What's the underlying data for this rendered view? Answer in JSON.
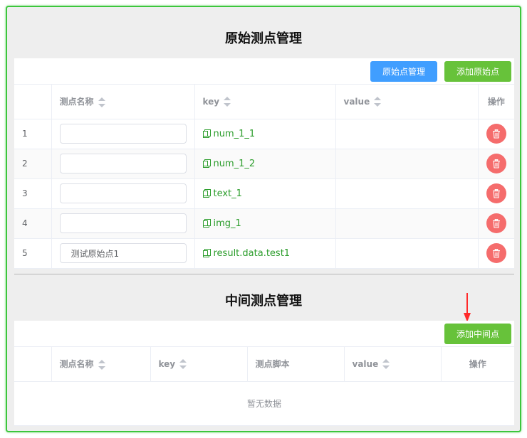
{
  "original": {
    "title": "原始测点管理",
    "buttons": {
      "manage": "原始点管理",
      "add": "添加原始点"
    },
    "columns": {
      "name": "测点名称",
      "key": "key",
      "value": "value",
      "action": "操作"
    },
    "rows": [
      {
        "index": "1",
        "name": "",
        "key": "num_1_1",
        "value": ""
      },
      {
        "index": "2",
        "name": "",
        "key": "num_1_2",
        "value": ""
      },
      {
        "index": "3",
        "name": "",
        "key": "text_1",
        "value": ""
      },
      {
        "index": "4",
        "name": "",
        "key": "img_1",
        "value": ""
      },
      {
        "index": "5",
        "name": "测试原始点1",
        "key": "result.data.test1",
        "value": ""
      }
    ]
  },
  "intermediate": {
    "title": "中间测点管理",
    "buttons": {
      "add": "添加中间点"
    },
    "columns": {
      "name": "测点名称",
      "key": "key",
      "script": "测点脚本",
      "value": "value",
      "action": "操作"
    },
    "empty_text": "暂无数据"
  },
  "colors": {
    "primary": "#409eff",
    "success": "#67c23a",
    "danger": "#f56c6c",
    "key_text": "#2c9d2c",
    "frame_border": "#3cc63c",
    "annotation_arrow": "#ff2a2a"
  },
  "icons": {
    "sort": "sort-caret-icon",
    "copy": "copy-icon",
    "delete": "trash-icon",
    "annotation": "red-arrow-icon"
  }
}
